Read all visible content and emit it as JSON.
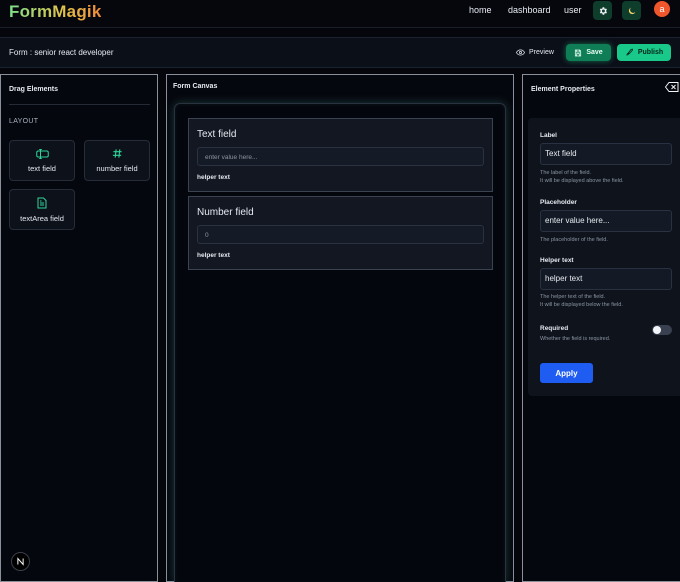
{
  "nav": {
    "logo": "FormMagik",
    "links": [
      "home",
      "dashboard",
      "user"
    ],
    "avatar_initial": "a",
    "icons": {
      "settings": "gear-icon",
      "theme": "moon-icon"
    }
  },
  "formbar": {
    "title": "Form : senior react developer",
    "preview_label": "Preview",
    "save_label": "Save",
    "publish_label": "Publish"
  },
  "drag_panel": {
    "title": "Drag Elements",
    "section": "LAYOUT",
    "elements": [
      {
        "label": "text field",
        "icon": "text-field-icon"
      },
      {
        "label": "number field",
        "icon": "hash-icon"
      },
      {
        "label": "textArea field",
        "icon": "file-text-icon"
      }
    ]
  },
  "canvas": {
    "title": "Form Canvas",
    "fields": [
      {
        "label": "Text field",
        "placeholder": "enter value here...",
        "helper": "helper text"
      },
      {
        "label": "Number field",
        "placeholder": "0",
        "helper": "helper text"
      }
    ]
  },
  "properties": {
    "title": "Element Properties",
    "label": {
      "title": "Label",
      "value": "Text field",
      "desc1": "The label of the field.",
      "desc2": "It will be displayed above the field."
    },
    "placeholder": {
      "title": "Placeholder",
      "value": "enter value here...",
      "desc1": "The placeholder of the field."
    },
    "helper": {
      "title": "Helper text",
      "value": "helper text",
      "desc1": "The helper text of the field.",
      "desc2": "It will be displayed below the field."
    },
    "required": {
      "title": "Required",
      "desc1": "Whether the field is required.",
      "value": false
    },
    "apply_label": "Apply"
  },
  "colors": {
    "accent": "#18c98a",
    "save": "#0f7d55",
    "apply": "#1e5cf2",
    "avatar": "#f0562b"
  }
}
